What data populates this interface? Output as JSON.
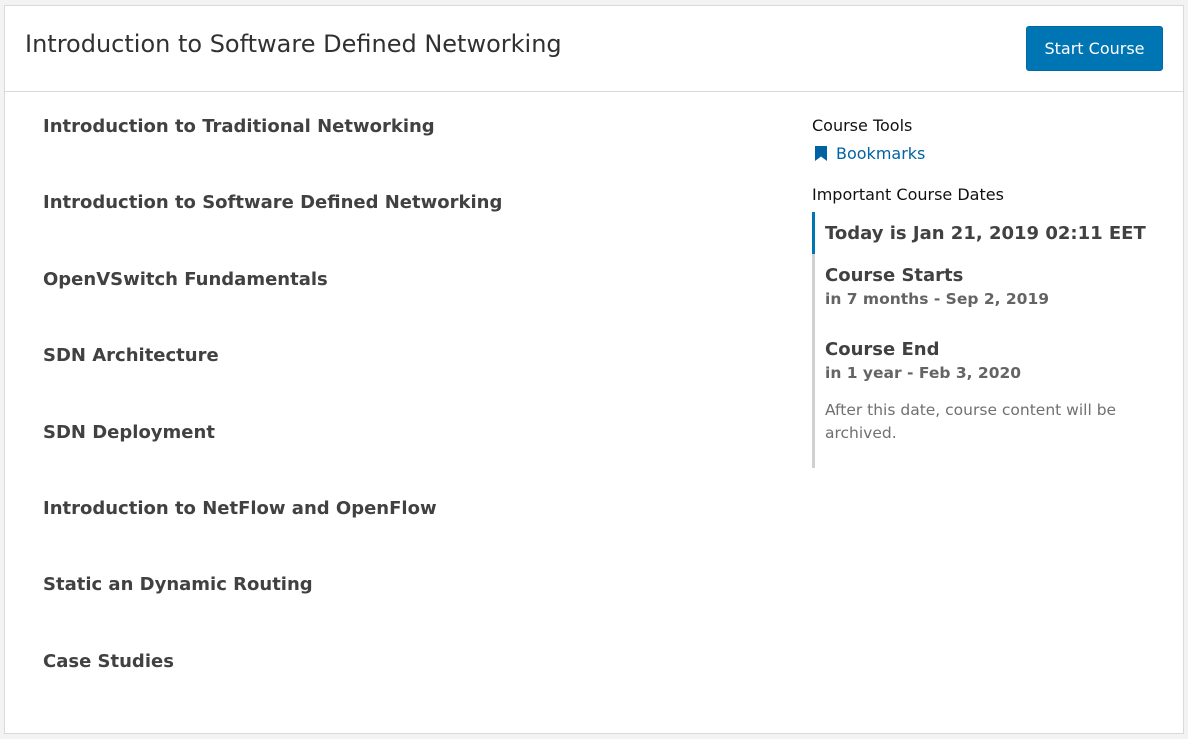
{
  "header": {
    "course_title": "Introduction to Software Defined Networking",
    "start_button": "Start Course"
  },
  "outline": {
    "sections": [
      "Introduction to Traditional Networking",
      "Introduction to Software Defined Networking",
      "OpenVSwitch Fundamentals",
      "SDN Architecture",
      "SDN Deployment",
      "Introduction to NetFlow and OpenFlow",
      "Static an Dynamic Routing",
      "Case Studies"
    ]
  },
  "sidebar": {
    "tools_title": "Course Tools",
    "bookmarks_label": "Bookmarks",
    "dates_title": "Important Course Dates",
    "today": "Today is Jan 21, 2019 02:11 EET",
    "course_starts": {
      "title": "Course Starts",
      "relative": "in 7 months - Sep 2, 2019"
    },
    "course_end": {
      "title": "Course End",
      "relative": "in 1 year - Feb 3, 2020",
      "description": "After this date, course content will be archived."
    }
  },
  "colors": {
    "accent": "#0075b4",
    "link": "#0062a3",
    "border": "#d9d9d9"
  },
  "icons": {
    "bookmark": "bookmark-icon"
  }
}
